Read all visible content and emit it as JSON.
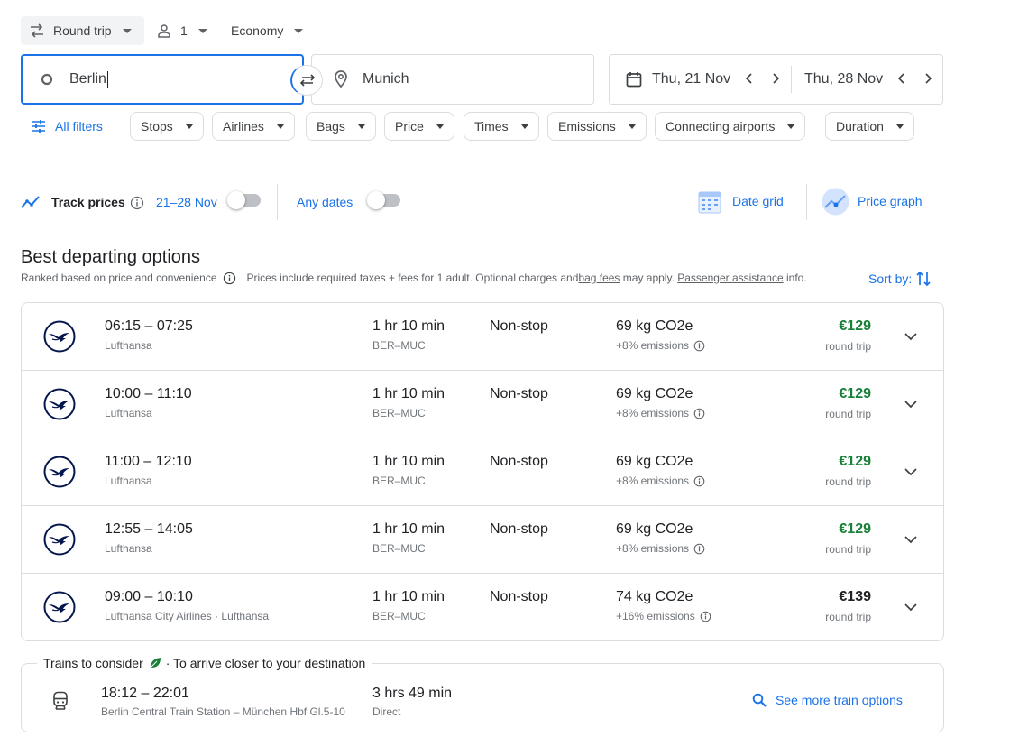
{
  "top": {
    "trip_type": "Round trip",
    "passengers": "1",
    "cabin": "Economy"
  },
  "search": {
    "origin": "Berlin",
    "destination": "Munich",
    "depart_date": "Thu, 21 Nov",
    "return_date": "Thu, 28 Nov"
  },
  "filters": {
    "all_filters": "All filters",
    "chips": [
      "Stops",
      "Airlines",
      "Bags",
      "Price",
      "Times",
      "Emissions",
      "Connecting airports",
      "Duration"
    ]
  },
  "tracking": {
    "track_prices": "Track prices",
    "track_range": "21–28 Nov",
    "any_dates": "Any dates",
    "date_grid": "Date grid",
    "price_graph": "Price graph"
  },
  "results": {
    "heading": "Best departing options",
    "ranked_note": "Ranked based on price and convenience",
    "prices_note_1": "Prices include required taxes + fees for 1 adult. Optional charges and ",
    "bag_fees": "bag fees",
    "prices_note_2": " may apply. ",
    "passenger_assistance": "Passenger assistance",
    "prices_note_3": " info.",
    "sort_by": "Sort by:"
  },
  "flights": [
    {
      "times": "06:15 – 07:25",
      "airline": "Lufthansa",
      "duration": "1 hr 10 min",
      "route": "BER–MUC",
      "stops": "Non-stop",
      "co2": "69 kg CO2e",
      "emissions": "+8% emissions",
      "price": "€129",
      "price_type": "round trip",
      "price_color": "#188038"
    },
    {
      "times": "10:00 – 11:10",
      "airline": "Lufthansa",
      "duration": "1 hr 10 min",
      "route": "BER–MUC",
      "stops": "Non-stop",
      "co2": "69 kg CO2e",
      "emissions": "+8% emissions",
      "price": "€129",
      "price_type": "round trip",
      "price_color": "#188038"
    },
    {
      "times": "11:00 – 12:10",
      "airline": "Lufthansa",
      "duration": "1 hr 10 min",
      "route": "BER–MUC",
      "stops": "Non-stop",
      "co2": "69 kg CO2e",
      "emissions": "+8% emissions",
      "price": "€129",
      "price_type": "round trip",
      "price_color": "#188038"
    },
    {
      "times": "12:55 – 14:05",
      "airline": "Lufthansa",
      "duration": "1 hr 10 min",
      "route": "BER–MUC",
      "stops": "Non-stop",
      "co2": "69 kg CO2e",
      "emissions": "+8% emissions",
      "price": "€129",
      "price_type": "round trip",
      "price_color": "#188038"
    },
    {
      "times": "09:00 – 10:10",
      "airline": "Lufthansa City Airlines · Lufthansa",
      "duration": "1 hr 10 min",
      "route": "BER–MUC",
      "stops": "Non-stop",
      "co2": "74 kg CO2e",
      "emissions": "+16% emissions",
      "price": "€139",
      "price_type": "round trip",
      "price_color": "#202124"
    }
  ],
  "trains": {
    "title": "Trains to consider",
    "subtitle": "· To arrive closer to your destination",
    "times": "18:12 – 22:01",
    "stations": "Berlin Central Train Station – München Hbf Gl.5-10",
    "duration": "3 hrs 49 min",
    "type": "Direct",
    "see_more": "See more train options"
  },
  "colors": {
    "accent": "#1a73e8",
    "price_green": "#188038",
    "lufthansa_navy": "#05164d"
  }
}
